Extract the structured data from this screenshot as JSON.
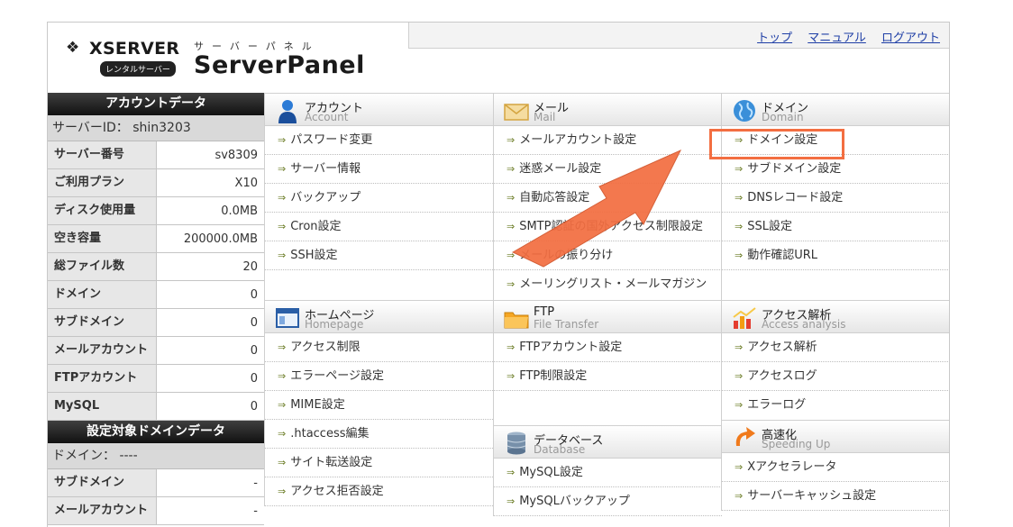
{
  "logo": {
    "brand": "XSERVER",
    "sub": "レンタルサーバー"
  },
  "product": {
    "kana": "サーバーパネル",
    "name": "ServerPanel"
  },
  "topnav": [
    "トップ",
    "マニュアル",
    "ログアウト"
  ],
  "account_panel": {
    "title": "アカウントデータ",
    "server_id": "サーバーID： shin3203",
    "rows": [
      {
        "k": "サーバー番号",
        "v": "sv8309"
      },
      {
        "k": "ご利用プラン",
        "v": "X10"
      },
      {
        "k": "ディスク使用量",
        "v": "0.0MB"
      },
      {
        "k": "空き容量",
        "v": "200000.0MB"
      },
      {
        "k": "総ファイル数",
        "v": "20"
      },
      {
        "k": "ドメイン",
        "v": "0"
      },
      {
        "k": "サブドメイン",
        "v": "0"
      },
      {
        "k": "メールアカウント",
        "v": "0"
      },
      {
        "k": "FTPアカウント",
        "v": "0"
      },
      {
        "k": "MySQL",
        "v": "0"
      }
    ]
  },
  "domain_panel": {
    "title": "設定対象ドメインデータ",
    "domain": "ドメイン： ----",
    "rows": [
      {
        "k": "サブドメイン",
        "v": "-"
      },
      {
        "k": "メールアカウント",
        "v": "-"
      }
    ]
  },
  "sections": {
    "account": {
      "jp": "アカウント",
      "en": "Account",
      "items": [
        "パスワード変更",
        "サーバー情報",
        "バックアップ",
        "Cron設定",
        "SSH設定"
      ]
    },
    "mail": {
      "jp": "メール",
      "en": "Mail",
      "items": [
        "メールアカウント設定",
        "迷惑メール設定",
        "自動応答設定",
        "SMTP認証の国外アクセス制限設定",
        "メールの振り分け",
        "メーリングリスト・メールマガジン"
      ]
    },
    "domain": {
      "jp": "ドメイン",
      "en": "Domain",
      "items": [
        "ドメイン設定",
        "サブドメイン設定",
        "DNSレコード設定",
        "SSL設定",
        "動作確認URL"
      ]
    },
    "homepage": {
      "jp": "ホームページ",
      "en": "Homepage",
      "items": [
        "アクセス制限",
        "エラーページ設定",
        "MIME設定",
        ".htaccess編集",
        "サイト転送設定",
        "アクセス拒否設定"
      ]
    },
    "ftp": {
      "jp": "FTP",
      "en": "File Transfer",
      "items": [
        "FTPアカウント設定",
        "FTP制限設定"
      ]
    },
    "database": {
      "jp": "データベース",
      "en": "Database",
      "items": [
        "MySQL設定",
        "MySQLバックアップ"
      ]
    },
    "analytics": {
      "jp": "アクセス解析",
      "en": "Access analysis",
      "items": [
        "アクセス解析",
        "アクセスログ",
        "エラーログ"
      ]
    },
    "speed": {
      "jp": "高速化",
      "en": "Speeding Up",
      "items": [
        "Xアクセラレータ",
        "サーバーキャッシュ設定"
      ]
    }
  },
  "colors": {
    "highlight": "#f36e41",
    "link": "#1f3fa6",
    "header_dark": "#222222"
  }
}
